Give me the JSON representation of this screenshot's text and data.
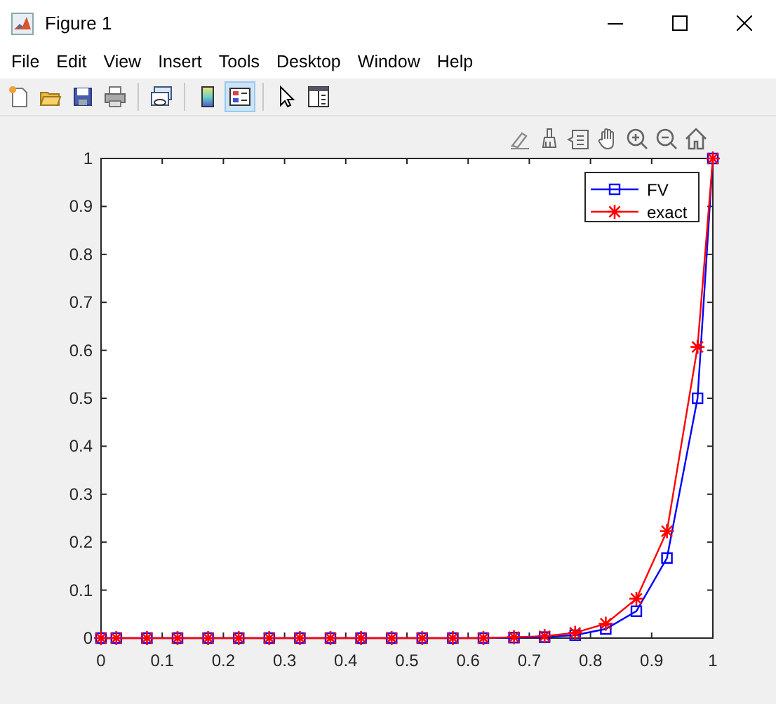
{
  "window": {
    "title": "Figure 1"
  },
  "menu": [
    "File",
    "Edit",
    "View",
    "Insert",
    "Tools",
    "Desktop",
    "Window",
    "Help"
  ],
  "toolbar": [
    {
      "kind": "new",
      "selected": false
    },
    {
      "kind": "open",
      "selected": false
    },
    {
      "kind": "save",
      "selected": false
    },
    {
      "kind": "print",
      "selected": false
    },
    {
      "kind": "sep"
    },
    {
      "kind": "link",
      "selected": false
    },
    {
      "kind": "sep"
    },
    {
      "kind": "colorbar",
      "selected": false
    },
    {
      "kind": "legend",
      "selected": true
    },
    {
      "kind": "sep"
    },
    {
      "kind": "pointer",
      "selected": false
    },
    {
      "kind": "property",
      "selected": false
    }
  ],
  "axes_toolbar": [
    {
      "kind": "edit"
    },
    {
      "kind": "brush"
    },
    {
      "kind": "datatip"
    },
    {
      "kind": "pan"
    },
    {
      "kind": "zoomin"
    },
    {
      "kind": "zoomout"
    },
    {
      "kind": "home"
    }
  ],
  "plot": {
    "chart_data": {
      "type": "line",
      "x": [
        0,
        0.025,
        0.075,
        0.125,
        0.175,
        0.225,
        0.275,
        0.325,
        0.375,
        0.425,
        0.475,
        0.525,
        0.575,
        0.625,
        0.675,
        0.725,
        0.775,
        0.825,
        0.875,
        0.925,
        0.975,
        1
      ],
      "series": [
        {
          "name": "FV",
          "color": "#0000ff",
          "marker": "square",
          "values": [
            0,
            0,
            0,
            0,
            0,
            0,
            0,
            0,
            0,
            0,
            0,
            0,
            0,
            0,
            0.001,
            0.002,
            0.006,
            0.019,
            0.056,
            0.167,
            0.5,
            1
          ]
        },
        {
          "name": "exact",
          "color": "#ff0000",
          "marker": "cross",
          "values": [
            0,
            0,
            0,
            0,
            0,
            0,
            0,
            0,
            0,
            0,
            0,
            0,
            0,
            0,
            0.002,
            0.004,
            0.011,
            0.03,
            0.082,
            0.223,
            0.607,
            1
          ]
        }
      ],
      "legend": true,
      "xlim": [
        0,
        1
      ],
      "ylim": [
        0,
        1
      ],
      "xticks": [
        0,
        0.1,
        0.2,
        0.3,
        0.4,
        0.5,
        0.6,
        0.7,
        0.8,
        0.9,
        1
      ],
      "yticks": [
        0,
        0.1,
        0.2,
        0.3,
        0.4,
        0.5,
        0.6,
        0.7,
        0.8,
        0.9,
        1
      ]
    }
  }
}
